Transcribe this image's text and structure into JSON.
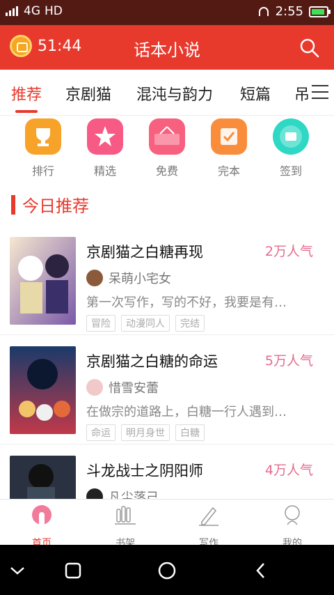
{
  "status": {
    "signal": "4G",
    "hd": "HD",
    "time": "2:55"
  },
  "app_bar": {
    "timer": "51:44",
    "title": "话本小说"
  },
  "tabs": [
    "推荐",
    "京剧猫",
    "混沌与韵力",
    "短篇",
    "吊"
  ],
  "quick_links": [
    {
      "label": "排行",
      "icon": "trophy-icon",
      "color": "#f7a32a"
    },
    {
      "label": "精选",
      "icon": "star-icon",
      "color": "#f75a85"
    },
    {
      "label": "免费",
      "icon": "free-sign-icon",
      "color": "#f7607e"
    },
    {
      "label": "完本",
      "icon": "check-icon",
      "color": "#f98d3b"
    },
    {
      "label": "签到",
      "icon": "sign-in-icon",
      "color": "#2ed8c4"
    }
  ],
  "section": {
    "title": "今日推荐"
  },
  "books": [
    {
      "title": "京剧猫之白糖再现",
      "popularity": "2万人气",
      "author": "呆萌小宅女",
      "desc": "第一次写作，写的不好，我要是有…",
      "tags": [
        "冒险",
        "动漫同人",
        "完结"
      ]
    },
    {
      "title": "京剧猫之白糖的命运",
      "popularity": "5万人气",
      "author": "惜雪安蕾",
      "desc": "在做宗的道路上，白糖一行人遇到…",
      "tags": [
        "命运",
        "明月身世",
        "白糖"
      ]
    },
    {
      "title": "斗龙战士之阴阳师",
      "popularity": "4万人气",
      "author": "凡尘落己",
      "desc": "",
      "tags": []
    }
  ],
  "bottom_nav": [
    {
      "label": "首页",
      "icon": "home-icon",
      "active": true
    },
    {
      "label": "书架",
      "icon": "bookshelf-icon",
      "active": false
    },
    {
      "label": "写作",
      "icon": "pen-icon",
      "active": false
    },
    {
      "label": "我的",
      "icon": "profile-icon",
      "active": false
    }
  ],
  "colors": {
    "primary": "#e8392d",
    "popularity": "#e56a8e",
    "status_bar": "#531a14"
  }
}
